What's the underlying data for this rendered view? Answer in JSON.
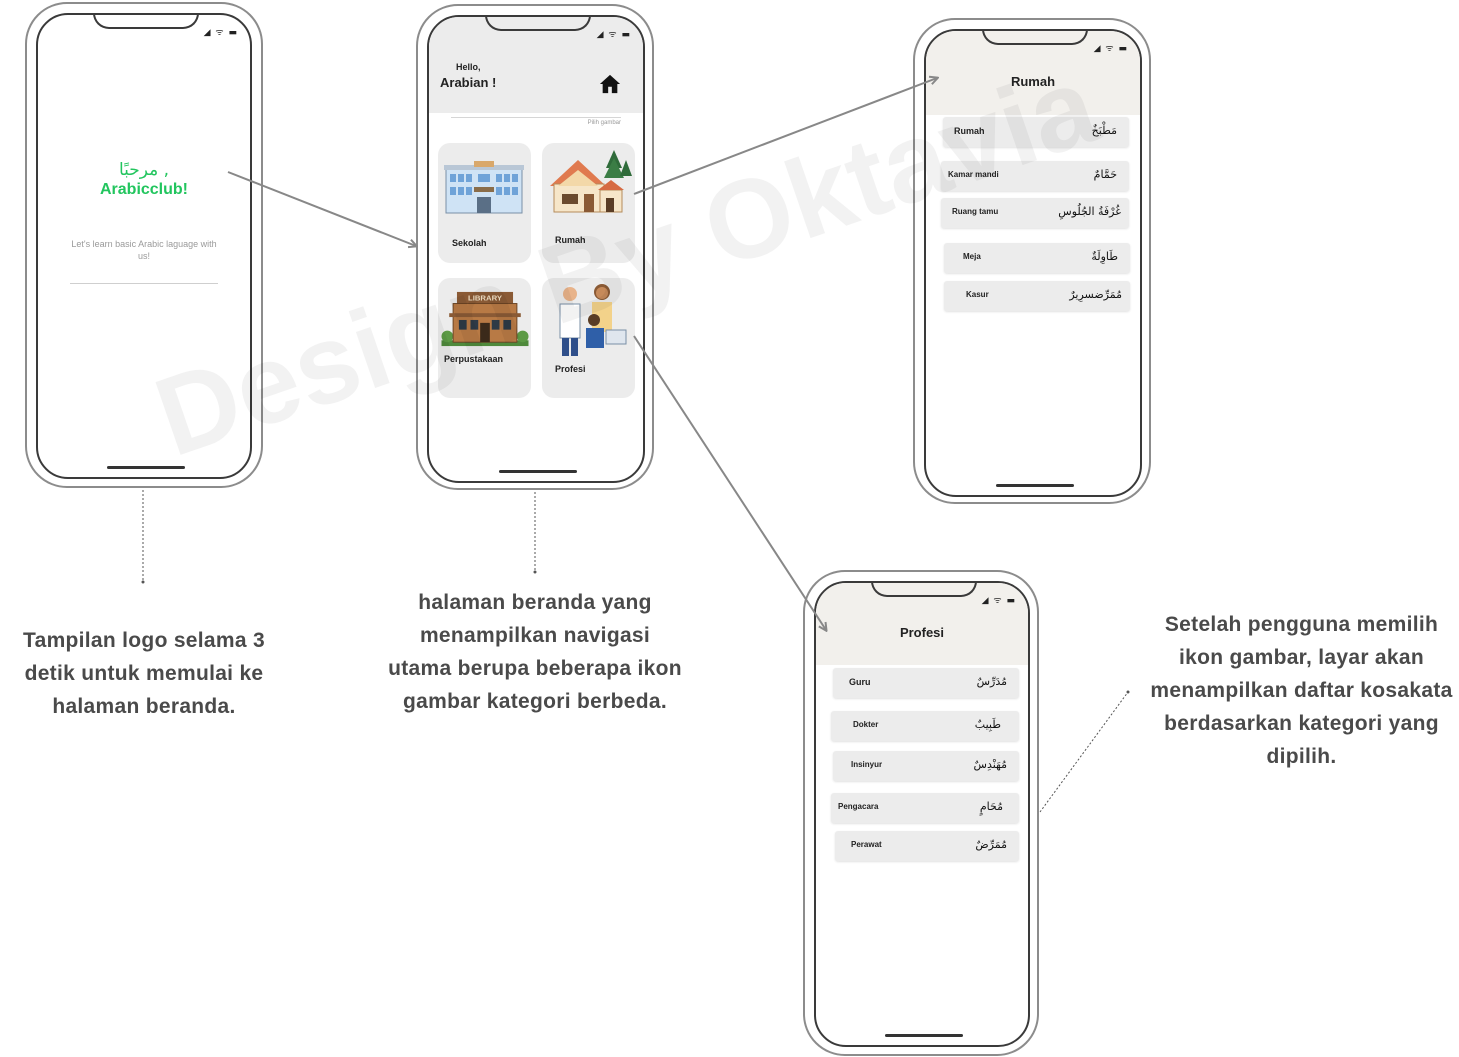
{
  "splash": {
    "arabic_greeting": "مرحبًا ,",
    "brand": "Arabicclub!",
    "tagline": "Let's learn basic Arabic laguage with us!"
  },
  "home": {
    "greeting": "Hello,",
    "username": "Arabian !",
    "pick_hint": "Pilih gambar",
    "categories": [
      {
        "label": "Sekolah",
        "icon": "school-building-icon"
      },
      {
        "label": "Rumah",
        "icon": "house-icon"
      },
      {
        "label": "Perpustakaan",
        "icon": "library-building-icon"
      },
      {
        "label": "Profesi",
        "icon": "professionals-icon"
      }
    ]
  },
  "rumah": {
    "title": "Rumah",
    "items": [
      {
        "id": "Rumah",
        "ar": "مَطْبَخٌ"
      },
      {
        "id": "Kamar mandi",
        "ar": "حَمَّامٌ"
      },
      {
        "id": "Ruang tamu",
        "ar": "غُرْفَةُ الجُلُوسِ"
      },
      {
        "id": "Meja",
        "ar": "طَاوِلَةٌ"
      },
      {
        "id": "Kasur",
        "ar": "مُمَرِّضسرِيرٌ"
      }
    ]
  },
  "profesi": {
    "title": "Profesi",
    "items": [
      {
        "id": "Guru",
        "ar": "مُدَرِّسٌ"
      },
      {
        "id": "Dokter",
        "ar": "طَبِيبٌ"
      },
      {
        "id": "Insinyur",
        "ar": "مُهَنْدِسٌ"
      },
      {
        "id": "Pengacara",
        "ar": "مُحَامٍ"
      },
      {
        "id": "Perawat",
        "ar": "مُمَرِّضٌ"
      }
    ]
  },
  "captions": {
    "splash": "Tampilan logo selama 3 detik untuk memulai  ke halaman beranda.",
    "home": "halaman beranda yang menampilkan navigasi utama berupa beberapa ikon gambar kategori berbeda.",
    "list": "Setelah pengguna memilih ikon gambar, layar akan menampilkan daftar kosakata berdasarkan kategori yang dipilih."
  },
  "watermark": "Design By Oktavia",
  "colors": {
    "brand_green": "#22c55e",
    "header_gray": "#ececec",
    "list_header": "#f2f0ec",
    "caption_text": "#4a4a4a"
  }
}
